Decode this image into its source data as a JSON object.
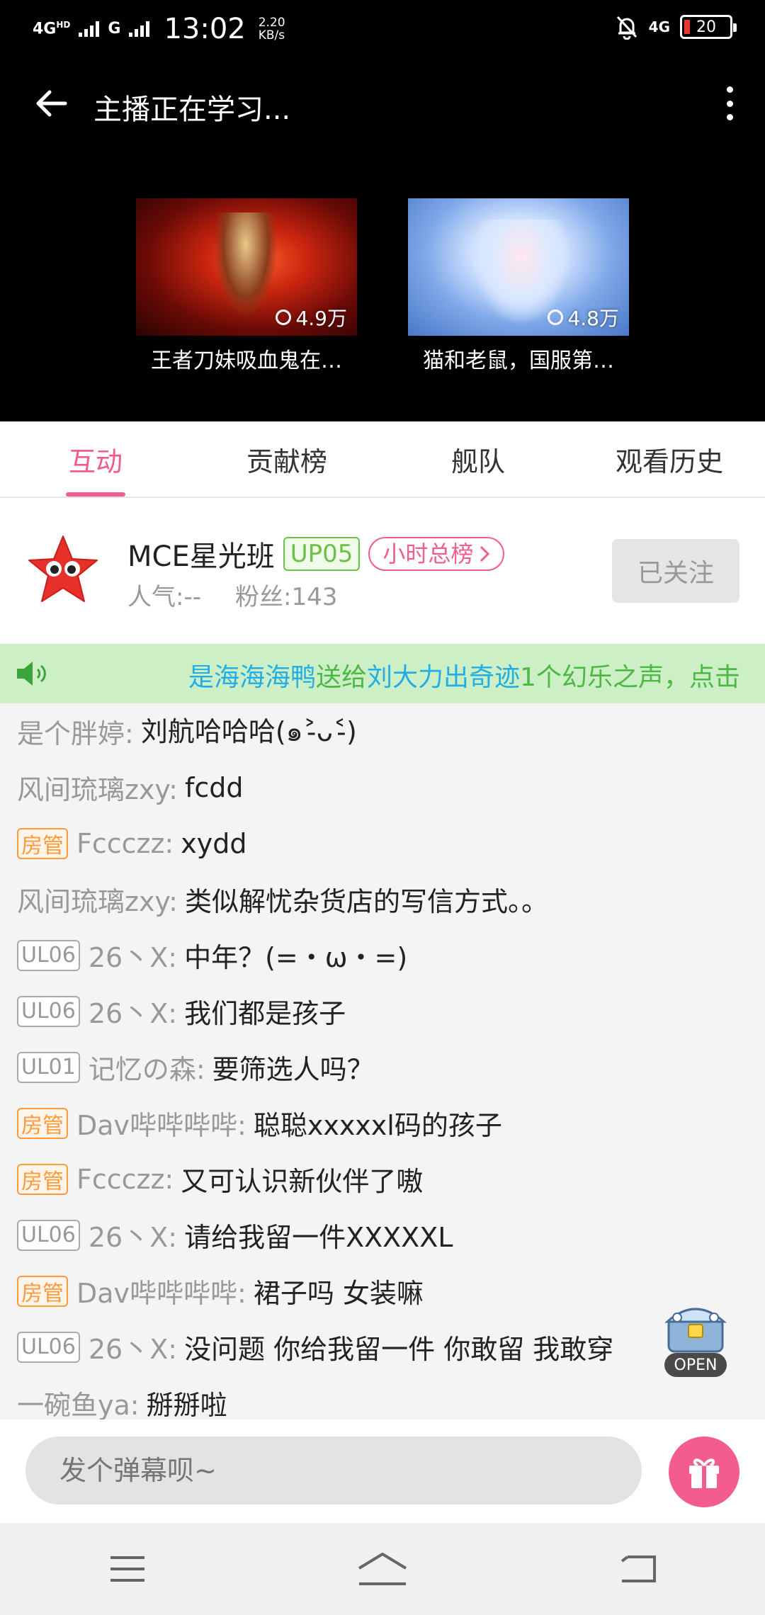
{
  "status_bar": {
    "network_left": "4G",
    "network_left_sup": "HD",
    "network_second": "G",
    "time": "13:02",
    "speed_value": "2.20",
    "speed_unit": "KB/s",
    "network_right": "4G",
    "battery": "20"
  },
  "header": {
    "title": "主播正在学习..."
  },
  "recommendations": [
    {
      "viewers": "4.9万",
      "caption": "王者刀妹吸血鬼在…"
    },
    {
      "viewers": "4.8万",
      "caption": "猫和老鼠，国服第…"
    }
  ],
  "tabs": [
    {
      "label": "互动",
      "active": true
    },
    {
      "label": "贡献榜",
      "active": false
    },
    {
      "label": "舰队",
      "active": false
    },
    {
      "label": "观看历史",
      "active": false
    }
  ],
  "anchor": {
    "name": "MCE星光班",
    "level": "UP05",
    "rank_label": "小时总榜",
    "popularity": "人气:--",
    "fans": "粉丝:143",
    "follow_label": "已关注"
  },
  "notice": {
    "sender": "是海海海鸭",
    "verb": "送给",
    "receiver": "刘大力出奇迹",
    "rest": "1个幻乐之声，点击"
  },
  "chat": [
    {
      "badge": "",
      "badge_type": "",
      "user": "是个胖婷:",
      "text": "刘航哈哈哈(๑˃̵ᴗ˂̵)"
    },
    {
      "badge": "",
      "badge_type": "",
      "user": "风间琉璃zxy:",
      "text": "fcdd"
    },
    {
      "badge": "房管",
      "badge_type": "admin",
      "user": "Fccczz:",
      "text": "xydd"
    },
    {
      "badge": "",
      "badge_type": "",
      "user": "风间琉璃zxy:",
      "text": "类似解忧杂货店的写信方式。。"
    },
    {
      "badge": "UL06",
      "badge_type": "ul",
      "user": "26丶X:",
      "text": "中年？(=・ω・=)"
    },
    {
      "badge": "UL06",
      "badge_type": "ul",
      "user": "26丶X:",
      "text": "我们都是孩子"
    },
    {
      "badge": "UL01",
      "badge_type": "ul",
      "user": "记忆の森:",
      "text": "要筛选人吗？"
    },
    {
      "badge": "房管",
      "badge_type": "admin",
      "user": "Dav哔哔哔哔:",
      "text": "聪聪xxxxxl码的孩子"
    },
    {
      "badge": "房管",
      "badge_type": "admin",
      "user": "Fccczz:",
      "text": "又可认识新伙伴了嗷"
    },
    {
      "badge": "UL06",
      "badge_type": "ul",
      "user": "26丶X:",
      "text": "请给我留一件XXXXXL"
    },
    {
      "badge": "房管",
      "badge_type": "admin",
      "user": "Dav哔哔哔哔:",
      "text": "裙子吗  女装嘛"
    },
    {
      "badge": "UL06",
      "badge_type": "ul",
      "user": "26丶X:",
      "text": "没问题  你给我留一件  你敢留 我敢穿"
    },
    {
      "badge": "",
      "badge_type": "",
      "user": "一碗鱼ya:",
      "text": "掰掰啦"
    }
  ],
  "treasure": {
    "label": "OPEN"
  },
  "input": {
    "placeholder": "发个弹幕呗~"
  },
  "colors": {
    "accent": "#f25d8e",
    "notice_bg": "#ccefc5",
    "level_green": "#6cc04a",
    "admin_orange": "#ff9a3b",
    "notice_blue": "#23ade5"
  },
  "icons": [
    "back-arrow-icon",
    "more-vert-icon",
    "speaker-icon",
    "gift-icon",
    "treasure-chest-icon",
    "menu-icon",
    "home-icon",
    "back-icon"
  ]
}
